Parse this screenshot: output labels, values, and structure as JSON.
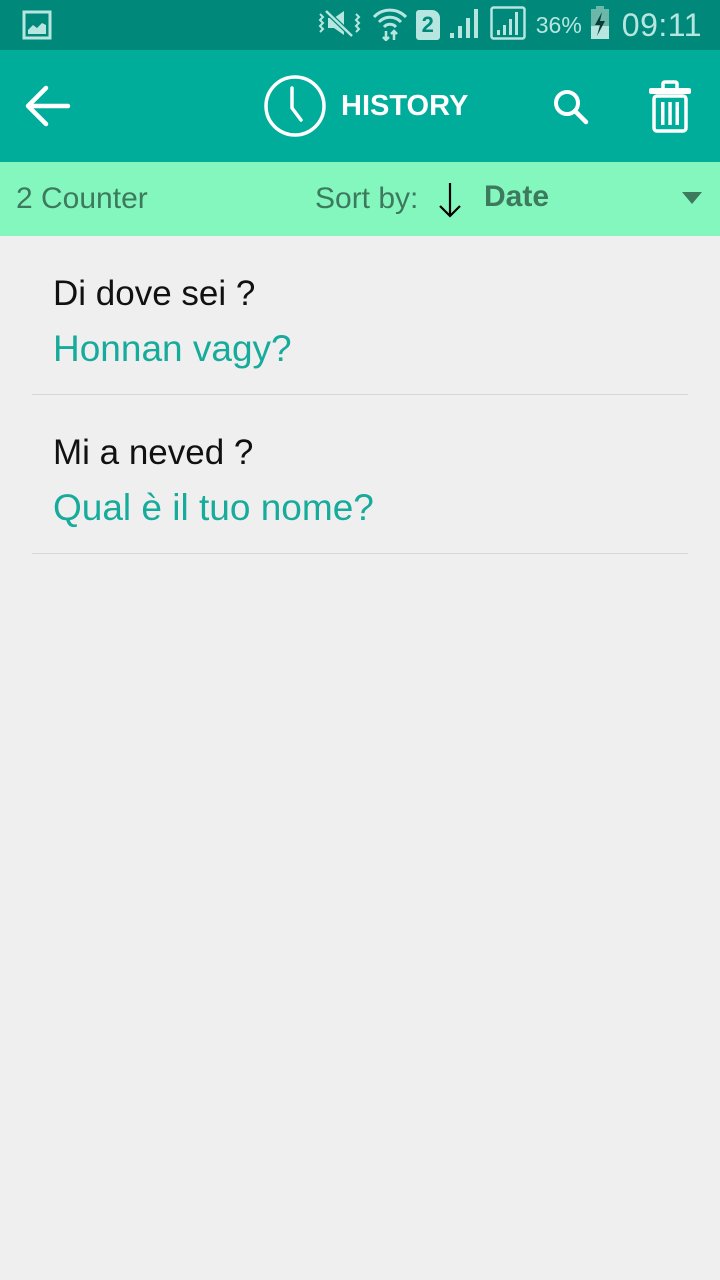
{
  "status_bar": {
    "notification_icon": "image-icon",
    "icons": [
      "vibrate-mute-icon",
      "wifi-icon",
      "sim-2-icon",
      "signal-icon",
      "signal-roaming-icon"
    ],
    "sim_label": "2",
    "battery_percent": "36%",
    "battery_icon": "battery-charging-icon",
    "time": "09:11"
  },
  "app_bar": {
    "back_icon": "arrow-left-icon",
    "title_icon": "clock-icon",
    "title": "HISTORY",
    "actions": [
      "search-icon",
      "trash-icon"
    ]
  },
  "sort_bar": {
    "counter": "2 Counter",
    "sort_label": "Sort by:",
    "sort_direction_icon": "arrow-down-icon",
    "sort_value": "Date",
    "dropdown_icon": "triangle-down-icon"
  },
  "history": [
    {
      "source": "Di dove sei ?",
      "translation": "Honnan vagy?"
    },
    {
      "source": "Mi a neved ?",
      "translation": "Qual è il tuo nome?"
    }
  ],
  "colors": {
    "status_bar": "#00897b",
    "app_bar": "#00ac9a",
    "sort_bar": "#84f7bf",
    "sort_text": "#3d7a5d",
    "translation_text": "#17ab9b",
    "background": "#efefef"
  }
}
